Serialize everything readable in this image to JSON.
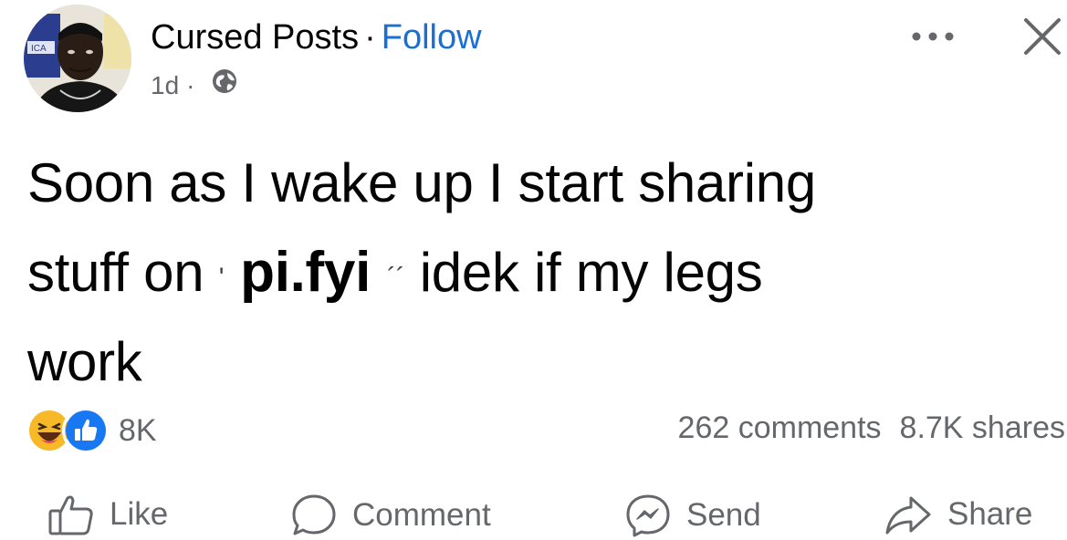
{
  "post": {
    "author": "Cursed Posts",
    "separator": "·",
    "follow_label": "Follow",
    "time": "1d",
    "time_separator": "·",
    "privacy_icon": "globe-icon",
    "more_icon": "more-icon",
    "close_icon": "close-icon",
    "text": {
      "line1": "Soon as I wake up I start sharing",
      "line2_before": "stuff on",
      "line2_tick1": "'",
      "watermark": "pi.fyi",
      "line2_tick2": "´´",
      "line2_after": "idek if my legs",
      "line3": "work"
    },
    "avatar_label": "ICA"
  },
  "stats": {
    "reaction_icons": [
      "haha-icon",
      "like-icon"
    ],
    "reaction_count": "8K",
    "comments": "262 comments",
    "shares": "8.7K shares"
  },
  "actions": {
    "like": "Like",
    "comment": "Comment",
    "send": "Send",
    "share": "Share"
  },
  "colors": {
    "follow": "#1a6fd6",
    "secondary_text": "#65676b",
    "like_blue": "#1877f2",
    "haha_yellow": "#f7b928"
  }
}
